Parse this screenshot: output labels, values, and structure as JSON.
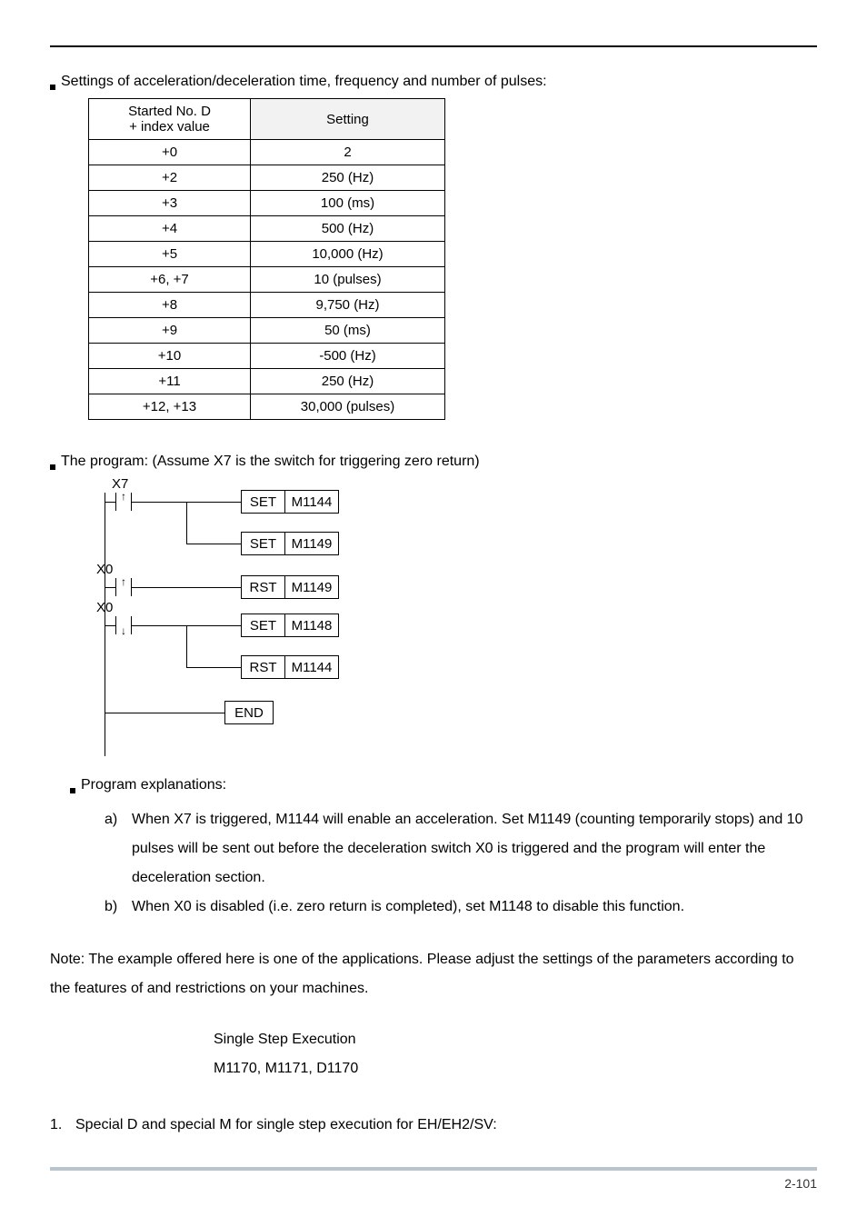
{
  "headings": {
    "bullet1": "Settings of acceleration/deceleration time, frequency and number of pulses:",
    "bullet2": "The program: (Assume X7 is the switch for triggering zero return)",
    "bullet3": "Program explanations:",
    "note": "Note: The example offered here is one of the applications. Please adjust the settings of the parameters according to the features of and restrictions on your machines.",
    "center1": "Single Step Execution",
    "center2": "M1170, M1171, D1170",
    "num1": "Special D and special M for single step execution for EH/EH2/SV:"
  },
  "table": {
    "h1a": "Started No. D",
    "h1b": "+ index value",
    "h2": "Setting",
    "rows": [
      {
        "c1": "+0",
        "c2": "2"
      },
      {
        "c1": "+2",
        "c2": "250 (Hz)"
      },
      {
        "c1": "+3",
        "c2": "100 (ms)"
      },
      {
        "c1": "+4",
        "c2": "500 (Hz)"
      },
      {
        "c1": "+5",
        "c2": "10,000 (Hz)"
      },
      {
        "c1": "+6, +7",
        "c2": "10 (pulses)"
      },
      {
        "c1": "+8",
        "c2": "9,750 (Hz)"
      },
      {
        "c1": "+9",
        "c2": "50 (ms)"
      },
      {
        "c1": "+10",
        "c2": "-500 (Hz)"
      },
      {
        "c1": "+11",
        "c2": "250 (Hz)"
      },
      {
        "c1": "+12, +13",
        "c2": "30,000 (pulses)"
      }
    ]
  },
  "ladder": {
    "x7": "X7",
    "x0a": "X0",
    "x0b": "X0",
    "boxes": [
      {
        "op": "SET",
        "arg": "M1144"
      },
      {
        "op": "SET",
        "arg": "M1149"
      },
      {
        "op": "RST",
        "arg": "M1149"
      },
      {
        "op": "SET",
        "arg": "M1148"
      },
      {
        "op": "RST",
        "arg": "M1144"
      }
    ],
    "end": "END"
  },
  "explain": {
    "a_mk": "a)",
    "a": "When X7 is triggered, M1144 will enable an acceleration. Set M1149 (counting temporarily stops) and 10 pulses will be sent out before the deceleration switch X0 is triggered and the program will enter the deceleration section.",
    "b_mk": "b)",
    "b": "When X0 is disabled (i.e. zero return is completed), set M1148 to disable this function."
  },
  "list": {
    "n1": "1."
  },
  "footer": {
    "page": "2-101"
  }
}
